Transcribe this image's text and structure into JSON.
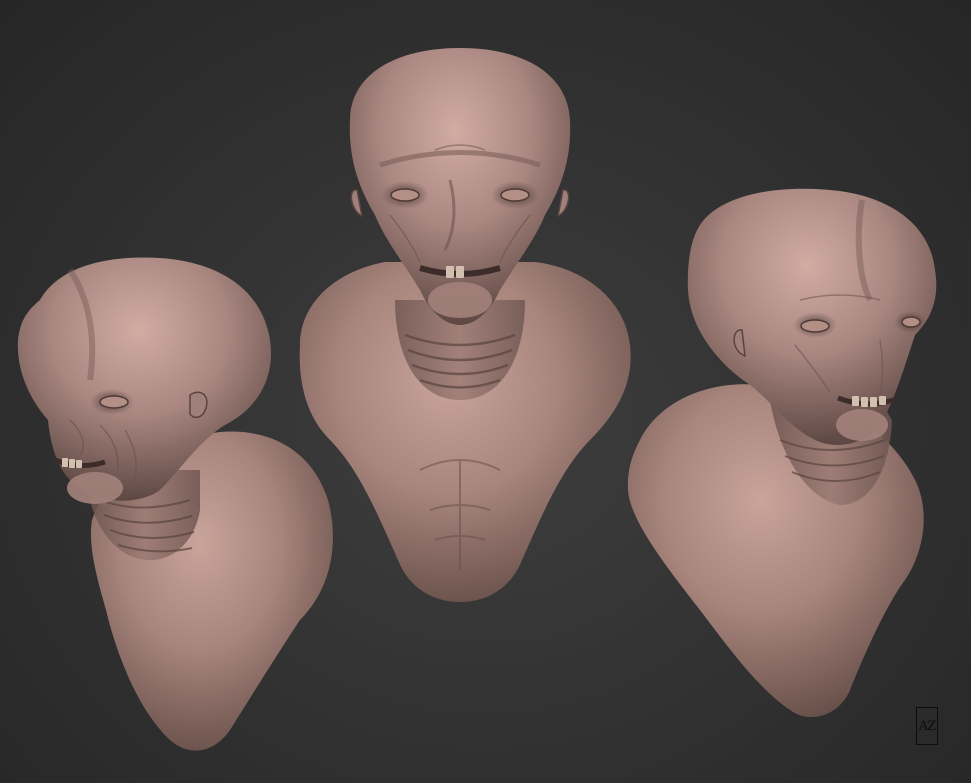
{
  "scene": {
    "background_color": "#333333",
    "sculpt_material_color": "#b49088",
    "views": [
      {
        "name": "three-quarter-left"
      },
      {
        "name": "front"
      },
      {
        "name": "three-quarter-right"
      }
    ]
  },
  "signature": {
    "monogram": "AZ"
  }
}
